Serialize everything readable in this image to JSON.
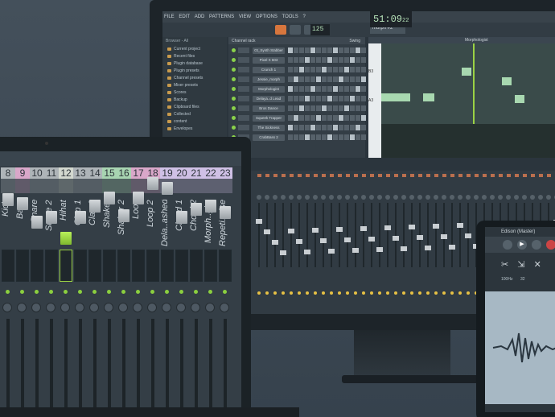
{
  "monitor": {
    "menu": [
      "FILE",
      "EDIT",
      "ADD",
      "PATTERNS",
      "VIEW",
      "OPTIONS",
      "TOOLS",
      "?"
    ],
    "time": "51:09",
    "time_sub": "22",
    "tempo": "125",
    "pattern": "morph #2",
    "hint": "Mor.phologist",
    "browser_header": "Browser - All",
    "browser_items": [
      "Current project",
      "Recent files",
      "Plugin database",
      "Plugin presets",
      "Channel presets",
      "Mixer presets",
      "Scores",
      "Backup",
      "Clipboard files",
      "Collected",
      "content",
      "Envelopes"
    ],
    "channel_rack_title": "Channel rack",
    "channel_swing": "Swing",
    "channels": [
      "Gt_Synth Stabber",
      "Pixel X 603",
      "Crunch 1",
      "Jessie_morph",
      "Morphologist",
      "Delaya..d Lead",
      "Bros Dance",
      "Squeek Trapper",
      "The Sickness",
      "CrabBass 2"
    ],
    "piano_roll_title": "Morphologist - Velocity",
    "piano_keys": [
      "B3",
      "A3"
    ]
  },
  "laptop": {
    "track_numbers": [
      "8",
      "9",
      "10",
      "11",
      "12",
      "13",
      "14",
      "15",
      "16",
      "17",
      "18",
      "19",
      "20",
      "21",
      "22",
      "23"
    ],
    "track_names": [
      "Kick",
      "Bass",
      "Snare",
      "Snare 2",
      "Hihat",
      "Clap 1",
      "Clap 2",
      "Shaker",
      "Shaker 2",
      "Loop",
      "Loop 2",
      "Dela..ashed",
      "Chord 1",
      "Chord 2",
      "Morph..gist",
      "Repeti..ulse"
    ],
    "selected_track": "12"
  },
  "tablet": {
    "title": "Edison (Master)",
    "readout_hz": "100Hz",
    "readout_num": "32"
  }
}
